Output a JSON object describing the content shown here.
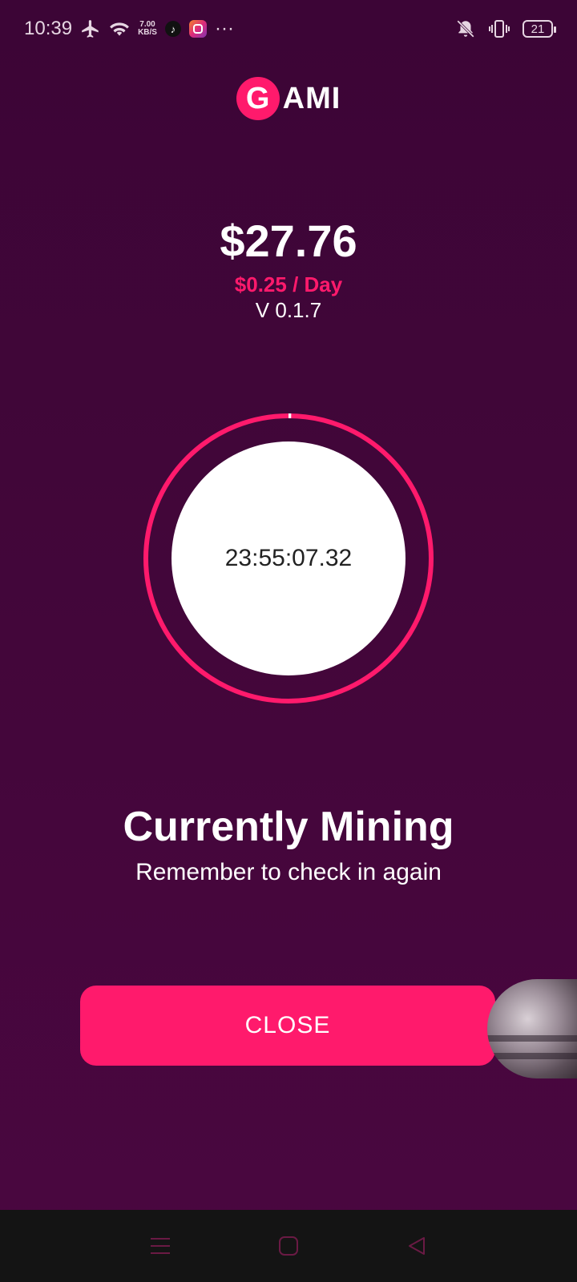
{
  "status_bar": {
    "time": "10:39",
    "net_speed_value": "7.00",
    "net_speed_unit": "KB/S",
    "more": "···",
    "battery": "21",
    "icons": [
      "airplane-icon",
      "wifi-icon",
      "tiktok-icon",
      "instagram-icon",
      "mute-icon",
      "vibrate-icon",
      "battery-icon"
    ]
  },
  "logo": {
    "letter": "G",
    "text": "AMI"
  },
  "wallet": {
    "balance": "$27.76",
    "rate": "$0.25 / Day",
    "version": "V 0.1.7"
  },
  "timer": {
    "value": "23:55:07.32",
    "progress": 0.003
  },
  "message": {
    "headline": "Currently Mining",
    "subline": "Remember to check in again"
  },
  "actions": {
    "close_label": "CLOSE"
  },
  "colors": {
    "accent": "#ff1a6c",
    "background": "#43063a",
    "nav_bar": "#141414"
  }
}
